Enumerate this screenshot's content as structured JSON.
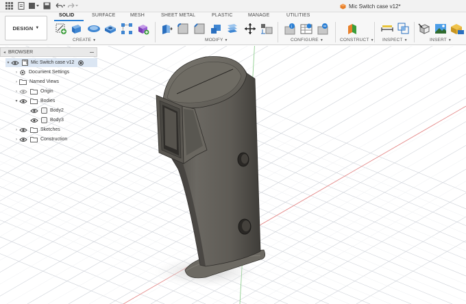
{
  "window": {
    "document_tab": "Mic Switch case v12*"
  },
  "ribbon": {
    "workspace_button": "DESIGN",
    "tabs": [
      "SOLID",
      "SURFACE",
      "MESH",
      "SHEET METAL",
      "PLASTIC",
      "MANAGE",
      "UTILITIES"
    ],
    "active_tab": "SOLID",
    "groups": [
      "CREATE",
      "MODIFY",
      "CONFIGURE",
      "CONSTRUCT",
      "INSPECT",
      "INSERT"
    ]
  },
  "browser": {
    "title": "BROWSER",
    "items": [
      {
        "label": "Mic Switch case v12",
        "level": 0,
        "icon": "component-icon"
      },
      {
        "label": "Document Settings",
        "level": 1,
        "icon": "gear-icon"
      },
      {
        "label": "Named Views",
        "level": 1,
        "icon": "folder-icon"
      },
      {
        "label": "Origin",
        "level": 1,
        "icon": "folder-icon"
      },
      {
        "label": "Bodies",
        "level": 1,
        "icon": "folder-icon"
      },
      {
        "label": "Body2",
        "level": 2,
        "icon": "body-icon"
      },
      {
        "label": "Body3",
        "level": 2,
        "icon": "body-icon"
      },
      {
        "label": "Sketches",
        "level": 1,
        "icon": "folder-icon"
      },
      {
        "label": "Construction",
        "level": 1,
        "icon": "folder-icon"
      }
    ]
  },
  "colors": {
    "accent": "#2a7fd4",
    "model": "#5f5c56",
    "grid": "#c9cdd4",
    "axis_red": "#e07b7b",
    "axis_green": "#7bc47b"
  }
}
